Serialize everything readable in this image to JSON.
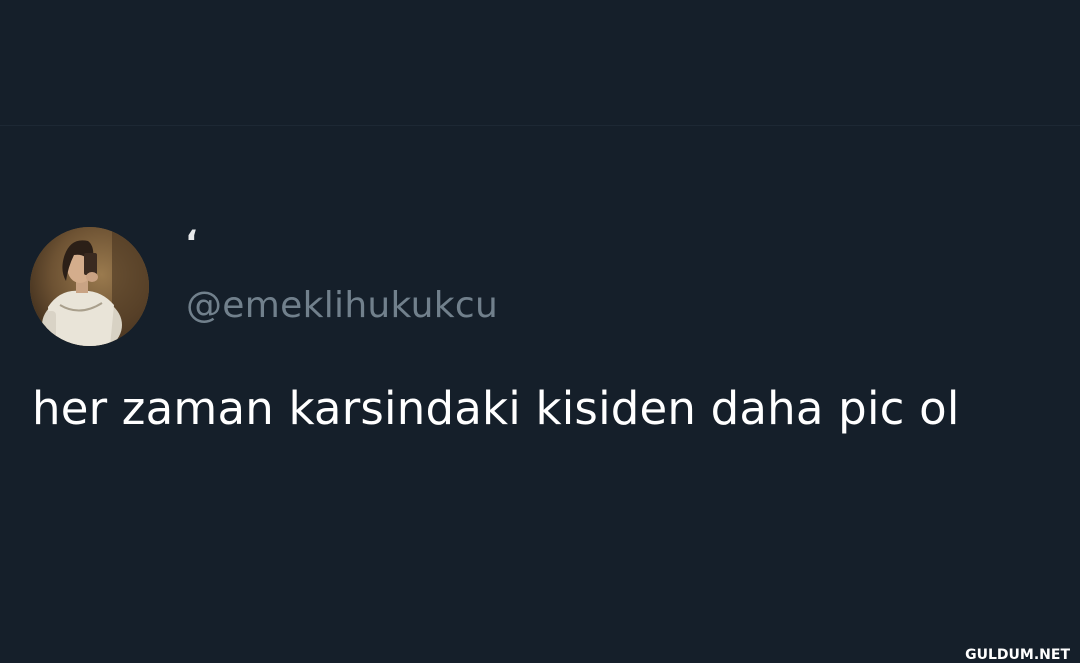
{
  "tweet": {
    "display_name": "‘",
    "handle": "@emeklihukukcu",
    "text": "her zaman karsindaki kisiden daha pic ol"
  },
  "watermark": "GULDUM.NET",
  "colors": {
    "background": "#151f2a",
    "text_primary": "#ffffff",
    "text_secondary": "#71808c"
  }
}
